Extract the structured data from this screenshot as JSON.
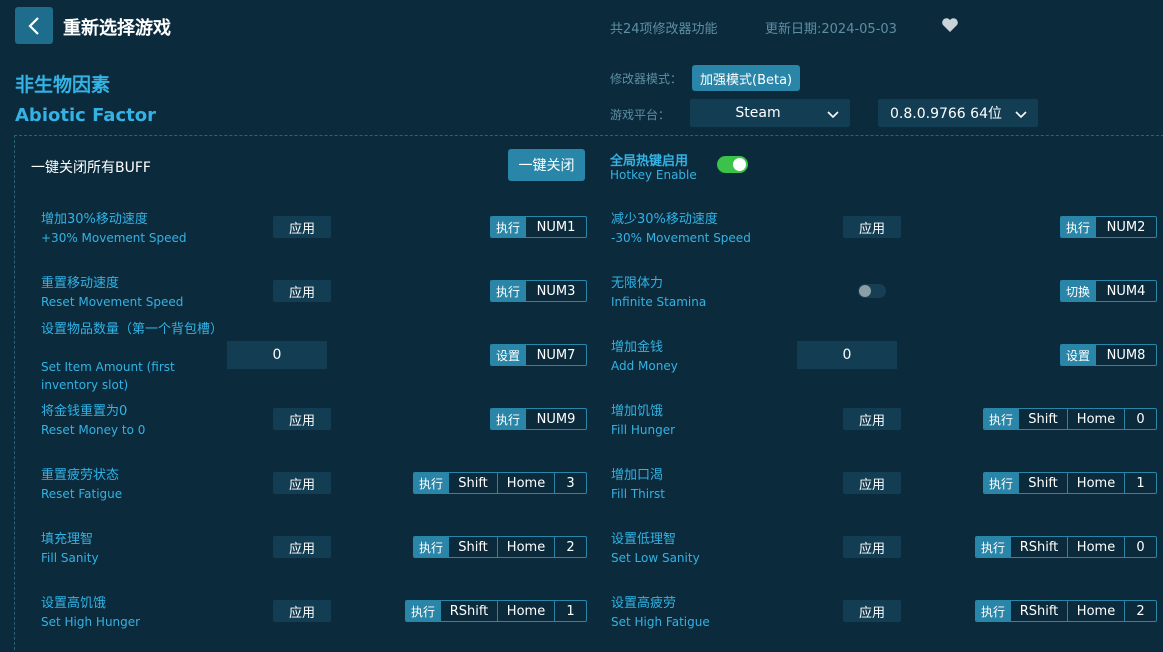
{
  "header": {
    "title": "重新选择游戏",
    "feature_count": "共24项修改器功能",
    "update_date": "更新日期:2024-05-03"
  },
  "game": {
    "name_cn": "非生物因素",
    "name_en": "Abiotic Factor"
  },
  "options": {
    "mode_label": "修改器模式：",
    "mode_value": "加强模式(Beta)",
    "platform_label": "游戏平台：",
    "platform_value": "Steam",
    "version_value": "0.8.0.9766 64位"
  },
  "top_row": {
    "buff_label": "一键关闭所有BUFF",
    "close_all_button": "一键关闭",
    "hotkey_cn": "全局热键启用",
    "hotkey_en": "Hotkey Enable",
    "hotkey_enabled": true
  },
  "features": [
    {
      "cn": "增加30%移动速度",
      "en": "+30% Movement Speed",
      "control": "应用",
      "tag": "执行",
      "keys": [
        "NUM1"
      ]
    },
    {
      "cn": "减少30%移动速度",
      "en": "-30% Movement Speed",
      "control": "应用",
      "tag": "执行",
      "keys": [
        "NUM2"
      ]
    },
    {
      "cn": "重置移动速度",
      "en": "Reset Movement Speed",
      "control": "应用",
      "tag": "执行",
      "keys": [
        "NUM3"
      ]
    },
    {
      "cn": "无限体力",
      "en": "Infinite Stamina",
      "toggle_on": false,
      "tag": "切换",
      "keys": [
        "NUM4"
      ]
    },
    {
      "cn": "设置物品数量（第一个背包槽）",
      "en": "Set Item Amount (first inventory slot)",
      "value": "0",
      "tag": "设置",
      "keys": [
        "NUM7"
      ]
    },
    {
      "cn": "增加金钱",
      "en": "Add Money",
      "value": "0",
      "tag": "设置",
      "keys": [
        "NUM8"
      ]
    },
    {
      "cn": "将金钱重置为0",
      "en": "Reset Money to 0",
      "control": "应用",
      "tag": "执行",
      "keys": [
        "NUM9"
      ]
    },
    {
      "cn": "增加饥饿",
      "en": "Fill Hunger",
      "control": "应用",
      "tag": "执行",
      "keys": [
        "Shift",
        "Home",
        "0"
      ]
    },
    {
      "cn": "重置疲劳状态",
      "en": "Reset Fatigue",
      "control": "应用",
      "tag": "执行",
      "keys": [
        "Shift",
        "Home",
        "3"
      ]
    },
    {
      "cn": "增加口渴",
      "en": "Fill Thirst",
      "control": "应用",
      "tag": "执行",
      "keys": [
        "Shift",
        "Home",
        "1"
      ]
    },
    {
      "cn": "填充理智",
      "en": "Fill Sanity",
      "control": "应用",
      "tag": "执行",
      "keys": [
        "Shift",
        "Home",
        "2"
      ]
    },
    {
      "cn": "设置低理智",
      "en": "Set Low Sanity",
      "control": "应用",
      "tag": "执行",
      "keys": [
        "RShift",
        "Home",
        "0"
      ]
    },
    {
      "cn": "设置高饥饿",
      "en": "Set High Hunger",
      "control": "应用",
      "tag": "执行",
      "keys": [
        "RShift",
        "Home",
        "1"
      ]
    },
    {
      "cn": "设置高疲劳",
      "en": "Set High Fatigue",
      "control": "应用",
      "tag": "执行",
      "keys": [
        "RShift",
        "Home",
        "2"
      ]
    }
  ],
  "colors": {
    "background": "#0b2b3d",
    "accent": "#2a86a8",
    "label": "#33b2e3",
    "toggle_on": "#3ac24a"
  }
}
